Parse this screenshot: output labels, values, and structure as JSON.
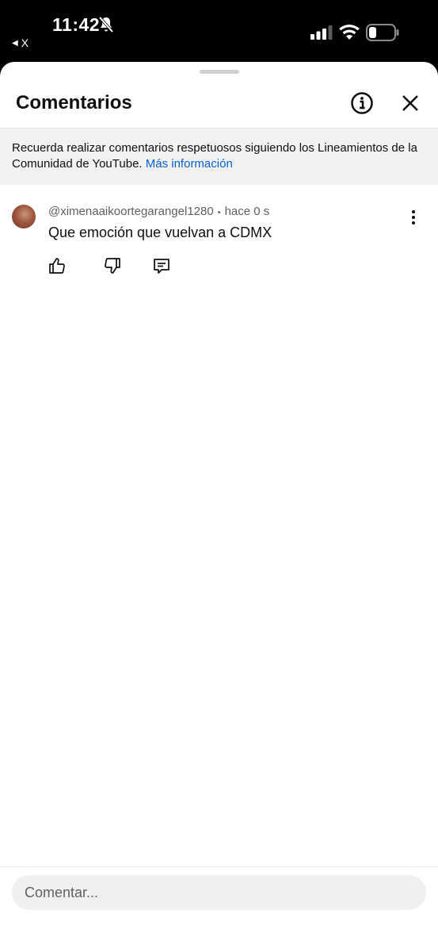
{
  "status_bar": {
    "time": "11:42",
    "back_app_label": "X",
    "icons": [
      "bell-off-icon",
      "signal-icon",
      "wifi-icon",
      "battery-icon"
    ]
  },
  "sheet": {
    "title": "Comentarios",
    "notice": {
      "text": "Recuerda realizar comentarios respetuosos siguiendo los Lineamientos de la Comunidad de YouTube.",
      "link": "Más información"
    },
    "comments": [
      {
        "author": "@ximenaaikoortegarangel1280",
        "separator": "•",
        "time": "hace 0 s",
        "text": "Que emoción que vuelvan a CDMX"
      }
    ],
    "composer": {
      "placeholder": "Comentar..."
    }
  },
  "colors": {
    "link": "#065fd4",
    "notice_bg": "#f2f2f2",
    "secondary_text": "#606060"
  }
}
